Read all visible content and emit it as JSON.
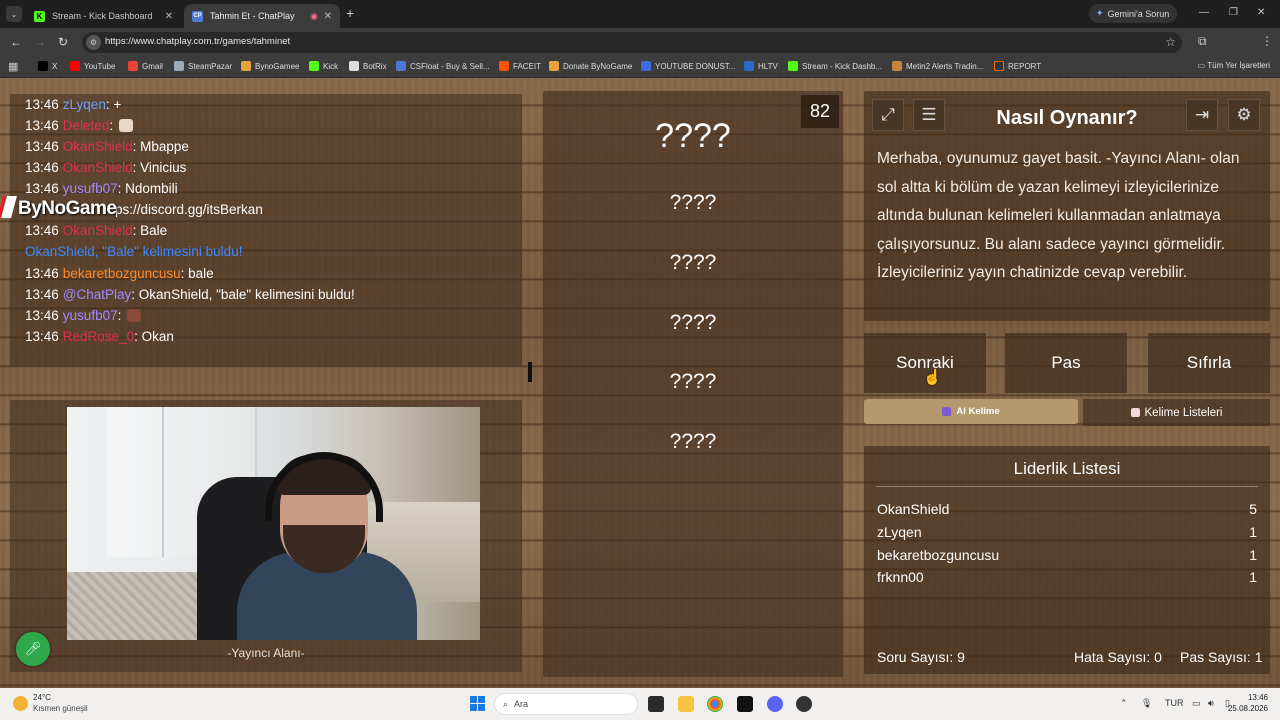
{
  "browser": {
    "tabs": [
      {
        "label": "Stream - Kick Dashboard",
        "active": false
      },
      {
        "label": "Tahmin Et - ChatPlay",
        "active": true
      }
    ],
    "gemini_label": "Gemini'a Sorun",
    "url": "https://www.chatplay.com.tr/games/tahminet",
    "bookmarks": [
      "X",
      "YouTube",
      "Gmail",
      "SteamPazar",
      "BynoGamee",
      "Kick",
      "BotRix",
      "CSFloat - Buy & Sell...",
      "FACEIT",
      "Donate ByNoGame",
      "YOUTUBE DONUST...",
      "HLTV",
      "Stream - Kick Dashb...",
      "Metin2 Alerts Tradin...",
      "REPORT"
    ],
    "all_bookmarks": "Tüm Yer İşaretleri"
  },
  "chat": {
    "overlay_logo": "ByNoGame",
    "lines": [
      {
        "time": "13:46",
        "user": "zLyqen",
        "user_color": "#6ea0ff",
        "text": "+"
      },
      {
        "time": "13:46",
        "user": "Deleted",
        "user_color": "#e0314a",
        "text": ""
      },
      {
        "time": "13:46",
        "user": "OkanShield",
        "user_color": "#e0314a",
        "text": "Mbappe"
      },
      {
        "time": "13:46",
        "user": "OkanShield",
        "user_color": "#e0314a",
        "text": "Vinicius"
      },
      {
        "time": "13:46",
        "user": "yusufb07",
        "user_color": "#a18bff",
        "text": "Ndombili"
      },
      {
        "time": "",
        "user": "",
        "user_color": "#ffffff",
        "text": "ps://discord.gg/itsBerkan"
      },
      {
        "time": "13:46",
        "user": "OkanShield",
        "user_color": "#e0314a",
        "text": "Bale"
      },
      {
        "time": "",
        "user": "",
        "user_color": "#3d8bff",
        "text": "OkanShield, \"Bale\" kelimesini buldu!"
      },
      {
        "time": "13:46",
        "user": "bekaretbozguncusu",
        "user_color": "#ff8a2a",
        "text": "bale"
      },
      {
        "time": "13:46",
        "user": "@ChatPlay",
        "user_color": "#a18bff",
        "text": "OkanShield, \"bale\" kelimesini buldu!"
      },
      {
        "time": "13:46",
        "user": "yusufb07",
        "user_color": "#a18bff",
        "text": ""
      },
      {
        "time": "13:46",
        "user": "RedRose_0",
        "user_color": "#e0314a",
        "text": "Okan"
      }
    ]
  },
  "streamer": {
    "label": "-Yayıncı Alanı-"
  },
  "game": {
    "timer": "82",
    "main_word": "????",
    "words": [
      "????",
      "????",
      "????",
      "????",
      "????"
    ]
  },
  "howto": {
    "title": "Nasıl Oynanır?",
    "text": "Merhaba, oyunumuz gayet basit. -Yayıncı Alanı- olan sol altta ki bölüm de yazan kelimeyi izleyicilerinize altında bulunan kelimeleri kullanmadan anlatmaya çalışıyorsunuz. Bu alanı sadece yayıncı görmelidir. İzleyicileriniz yayın chatinizde cevap verebilir."
  },
  "actions": {
    "next": "Sonraki",
    "pass": "Pas",
    "reset": "Sıfırla",
    "ai_word": "AI Kelime",
    "word_lists": "Kelime Listeleri"
  },
  "leaderboard": {
    "title": "Liderlik Listesi",
    "rows": [
      {
        "name": "OkanShield",
        "score": "5"
      },
      {
        "name": "zLyqen",
        "score": "1"
      },
      {
        "name": "bekaretbozguncusu",
        "score": "1"
      },
      {
        "name": "frknn00",
        "score": "1"
      }
    ],
    "question_count": "Soru Sayısı: 9",
    "error_count": "Hata Sayısı: 0",
    "pass_count": "Pas Sayısı: 1"
  },
  "taskbar": {
    "temp": "24°C",
    "weather": "Kısmen güneşli",
    "search_placeholder": "Ara",
    "lang": "TUR",
    "time": "13:46",
    "date": "25.08.2026"
  },
  "colors": {
    "accent_green": "#2ea84a",
    "ai_button": "#b4996f",
    "system_message": "#3d8bff"
  }
}
